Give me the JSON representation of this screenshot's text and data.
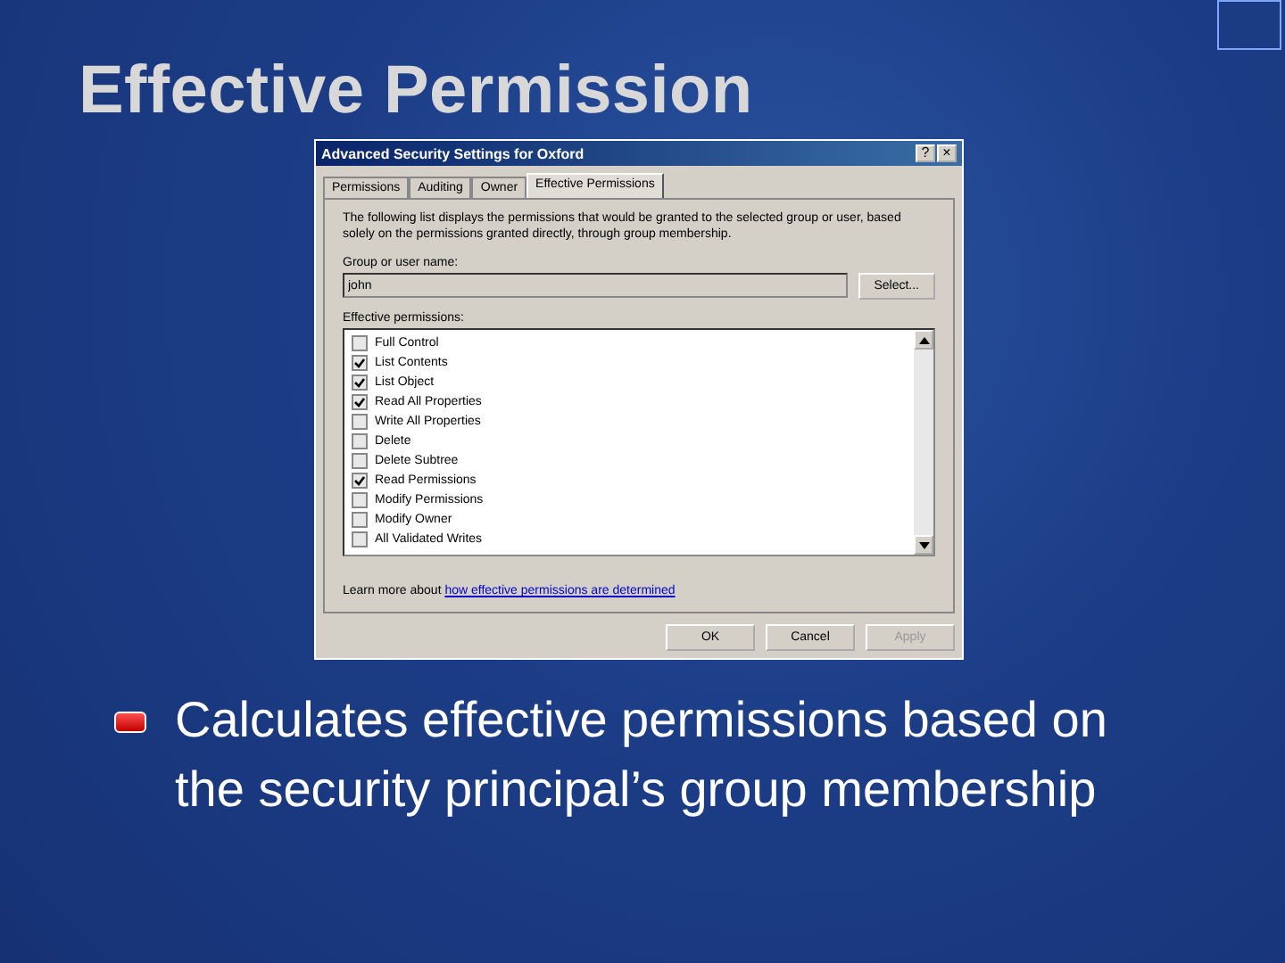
{
  "slide": {
    "title": "Effective Permission"
  },
  "dialog": {
    "title": "Advanced Security Settings for Oxford",
    "help_button": "?",
    "close_button": "×",
    "tabs": [
      {
        "label": "Permissions",
        "selected": false
      },
      {
        "label": "Auditing",
        "selected": false
      },
      {
        "label": "Owner",
        "selected": false
      },
      {
        "label": "Effective Permissions",
        "selected": true
      }
    ],
    "description": "The following list displays the permissions that would be granted to the selected group or user, based solely on the permissions granted directly, through group membership.",
    "group_label": "Group or user name:",
    "group_value": "john",
    "select_button": "Select...",
    "permissions_label": "Effective permissions:",
    "permissions": [
      {
        "label": "Full Control",
        "checked": false
      },
      {
        "label": "List Contents",
        "checked": true
      },
      {
        "label": "List Object",
        "checked": true
      },
      {
        "label": "Read All Properties",
        "checked": true
      },
      {
        "label": "Write All Properties",
        "checked": false
      },
      {
        "label": "Delete",
        "checked": false
      },
      {
        "label": "Delete Subtree",
        "checked": false
      },
      {
        "label": "Read Permissions",
        "checked": true
      },
      {
        "label": "Modify Permissions",
        "checked": false
      },
      {
        "label": "Modify Owner",
        "checked": false
      },
      {
        "label": "All Validated Writes",
        "checked": false
      }
    ],
    "learn_more_prefix": "Learn more about",
    "learn_more_link": "how effective permissions are determined",
    "buttons": [
      {
        "label": "OK",
        "disabled": false
      },
      {
        "label": "Cancel",
        "disabled": false
      },
      {
        "label": "Apply",
        "disabled": true
      }
    ]
  },
  "bullets": [
    "Calculates effective permissions based on the security principal’s group membership"
  ]
}
